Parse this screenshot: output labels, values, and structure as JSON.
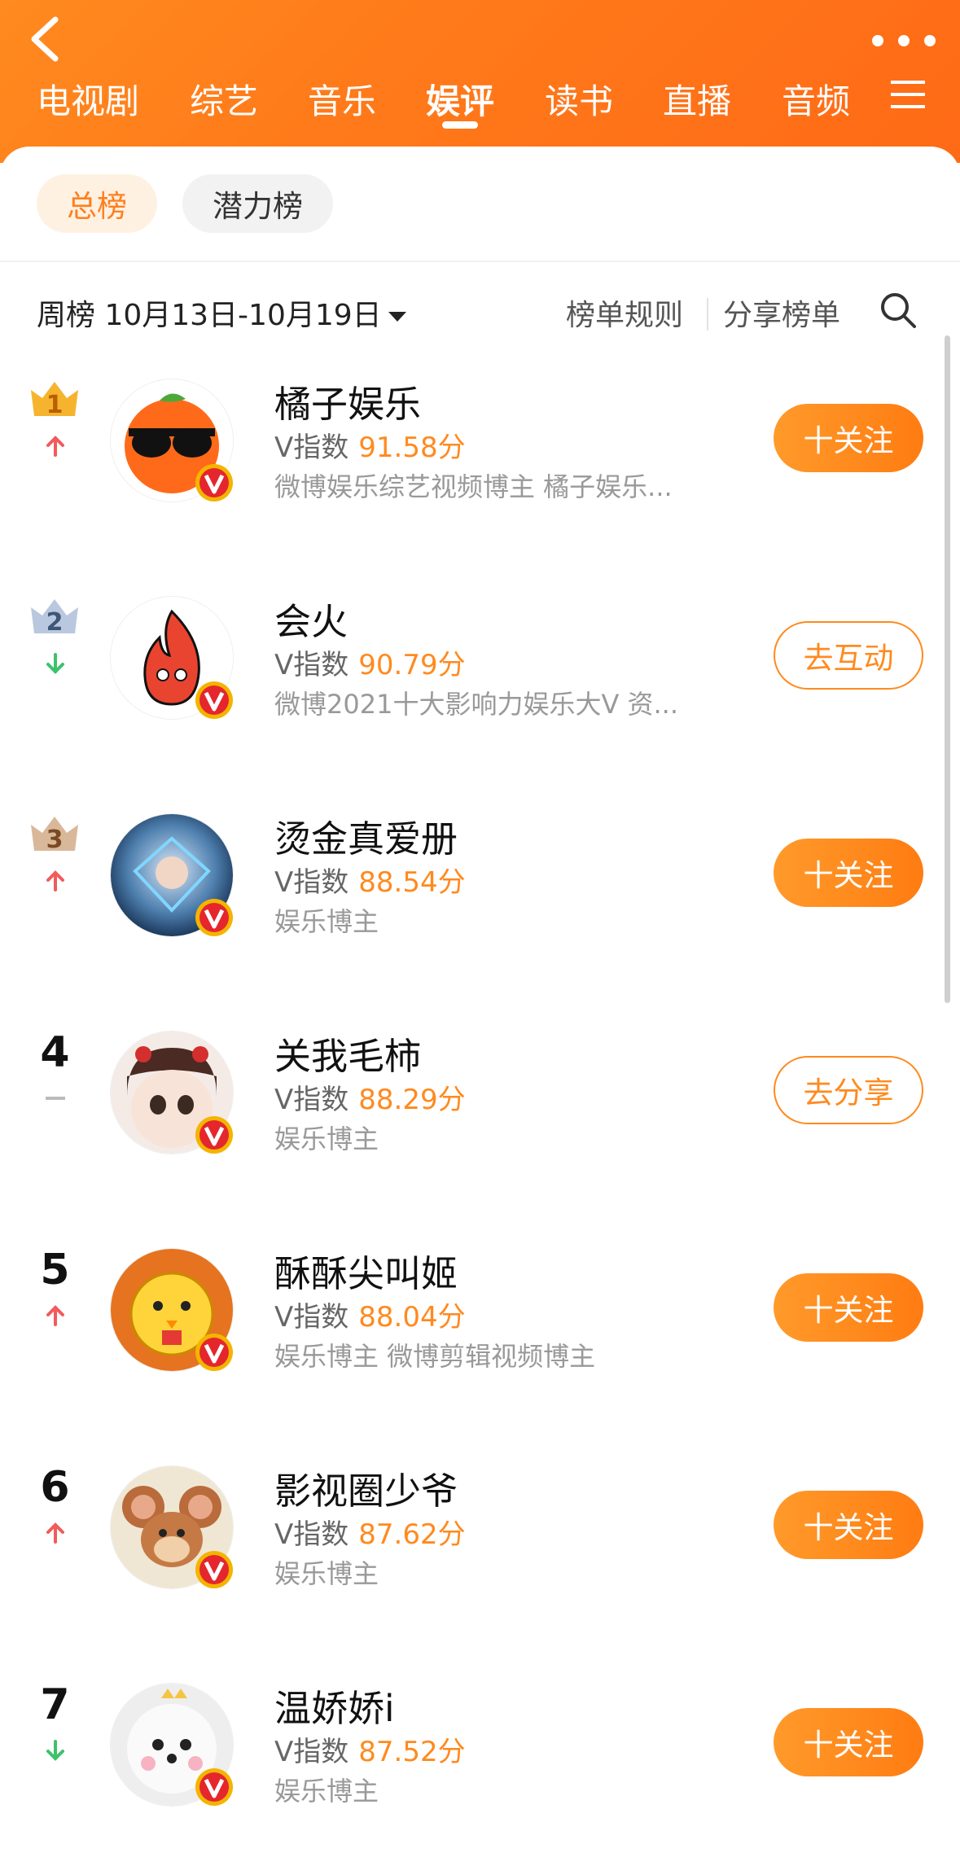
{
  "colors": {
    "accent": "#ff8a1f",
    "up": "#f25b5b",
    "down": "#3cc36b",
    "flat": "#bbbbbb"
  },
  "tabs": [
    {
      "label": "电视剧",
      "active": false
    },
    {
      "label": "综艺",
      "active": false
    },
    {
      "label": "音乐",
      "active": false
    },
    {
      "label": "娱评",
      "active": true
    },
    {
      "label": "读书",
      "active": false
    },
    {
      "label": "直播",
      "active": false
    },
    {
      "label": "音频",
      "active": false
    }
  ],
  "filters": {
    "total": "总榜",
    "potential": "潜力榜"
  },
  "period": {
    "label": "周榜 10月13日-10月19日",
    "rules": "榜单规则",
    "share": "分享榜单"
  },
  "score_label": "V指数",
  "list": [
    {
      "rank": "1",
      "trend": "up",
      "name": "橘子娱乐",
      "score": "91.58分",
      "desc": "微博娱乐综艺视频博主 橘子娱乐...",
      "action": "十关注",
      "action_style": "follow",
      "avatar": "orange-sunglasses-avatar"
    },
    {
      "rank": "2",
      "trend": "down",
      "name": "会火",
      "score": "90.79分",
      "desc": "微博2021十大影响力娱乐大V 资...",
      "action": "去互动",
      "action_style": "outline",
      "avatar": "fire-avatar"
    },
    {
      "rank": "3",
      "trend": "up",
      "name": "烫金真爱册",
      "score": "88.54分",
      "desc": "娱乐博主",
      "action": "十关注",
      "action_style": "follow",
      "avatar": "blue-photo-avatar"
    },
    {
      "rank": "4",
      "trend": "flat",
      "name": "关我毛柿",
      "score": "88.29分",
      "desc": "娱乐博主",
      "action": "去分享",
      "action_style": "outline",
      "avatar": "cartoon-girl-avatar"
    },
    {
      "rank": "5",
      "trend": "up",
      "name": "酥酥尖叫姬",
      "score": "88.04分",
      "desc": "娱乐博主 微博剪辑视频博主",
      "action": "十关注",
      "action_style": "follow",
      "avatar": "yellow-chick-avatar"
    },
    {
      "rank": "6",
      "trend": "up",
      "name": "影视圈少爷",
      "score": "87.62分",
      "desc": "娱乐博主",
      "action": "十关注",
      "action_style": "follow",
      "avatar": "mouse-cartoon-avatar"
    },
    {
      "rank": "7",
      "trend": "down",
      "name": "温娇娇i",
      "score": "87.52分",
      "desc": "娱乐博主",
      "action": "十关注",
      "action_style": "follow",
      "avatar": "white-dog-avatar"
    }
  ]
}
